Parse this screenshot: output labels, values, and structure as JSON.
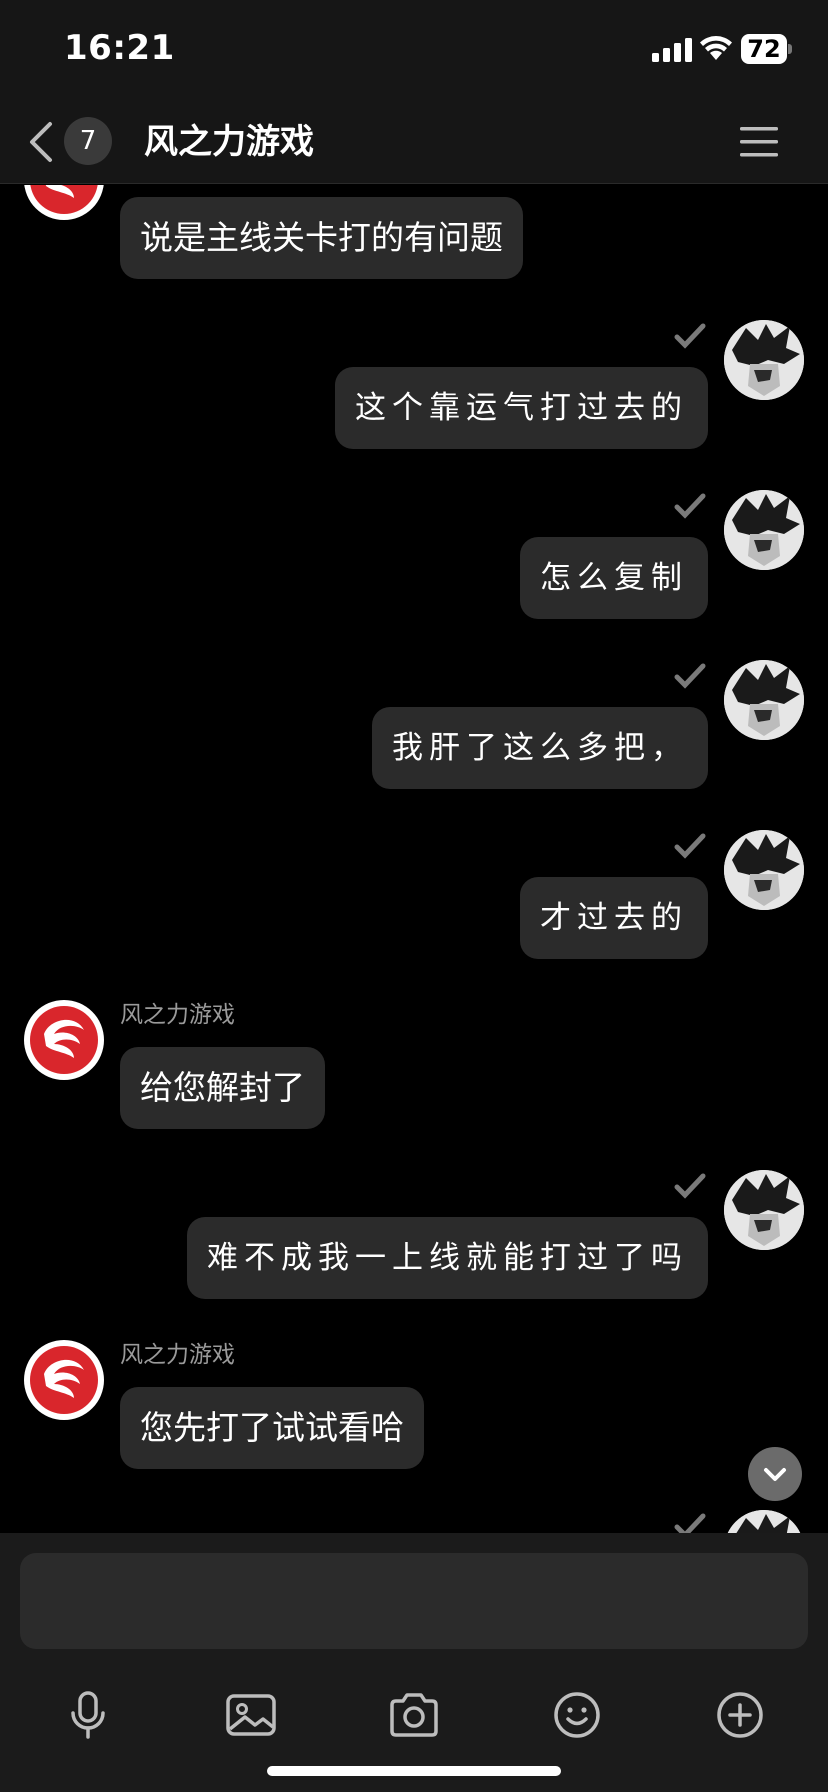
{
  "status_bar": {
    "time": "16:21",
    "battery": "72"
  },
  "nav": {
    "unread_count": "7",
    "title": "风之力游戏"
  },
  "messages": [
    {
      "side": "left",
      "text": "说是主线关卡打的有问题"
    },
    {
      "side": "right",
      "text": "这个靠运气打过去的"
    },
    {
      "side": "right",
      "text": "怎么复制"
    },
    {
      "side": "right",
      "text": "我肝了这么多把，"
    },
    {
      "side": "right",
      "text": "才过去的"
    },
    {
      "side": "left",
      "sender": "风之力游戏",
      "text": "给您解封了"
    },
    {
      "side": "right",
      "text": "难不成我一上线就能打过了吗"
    },
    {
      "side": "left",
      "sender": "风之力游戏",
      "text": "您先打了试试看哈"
    }
  ],
  "input": {
    "placeholder": ""
  },
  "toolbar": [
    "microphone-icon",
    "image-icon",
    "camera-icon",
    "emoji-icon",
    "plus-icon"
  ],
  "colors": {
    "background": "#000000",
    "bar": "#161616",
    "bubble": "#2b2b2b",
    "brand_red": "#d9262c"
  }
}
